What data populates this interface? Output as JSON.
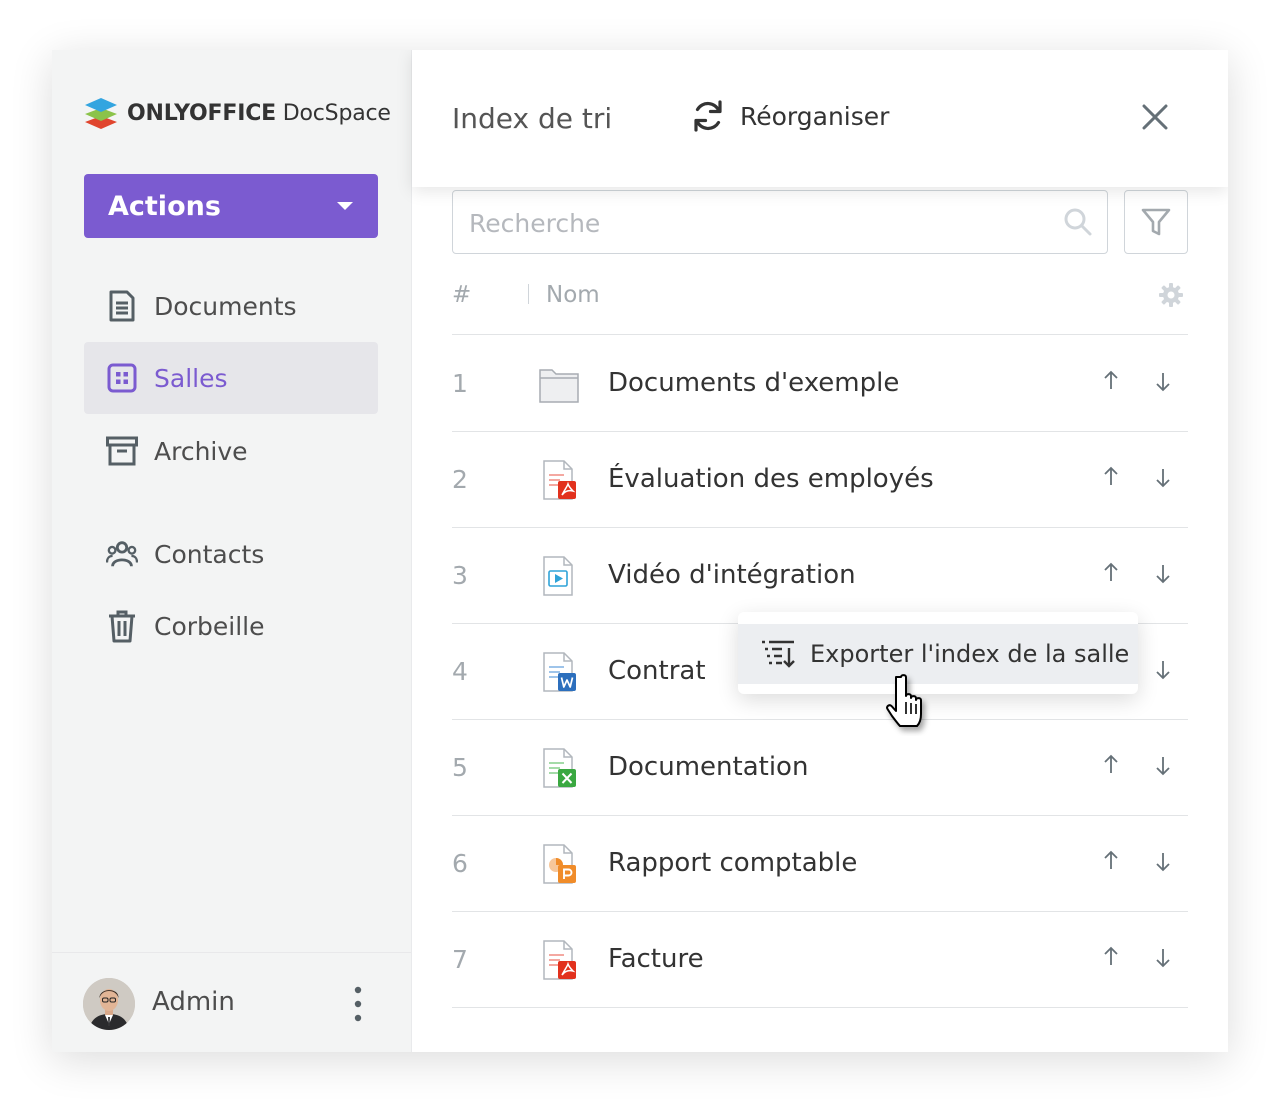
{
  "app": {
    "brand_bold": "ONLYOFFICE",
    "brand_light": " DocSpace"
  },
  "sidebar": {
    "actions_label": "Actions",
    "items": [
      {
        "label": "Documents",
        "icon": "document-icon",
        "active": false
      },
      {
        "label": "Salles",
        "icon": "rooms-icon",
        "active": true
      },
      {
        "label": "Archive",
        "icon": "archive-icon",
        "active": false
      },
      {
        "label": "Contacts",
        "icon": "contacts-icon",
        "active": false
      },
      {
        "label": "Corbeille",
        "icon": "trash-icon",
        "active": false
      }
    ],
    "user": {
      "name": "Admin"
    }
  },
  "panel": {
    "title": "Index de tri",
    "reorganize_label": "Réorganiser",
    "search_placeholder": "Recherche",
    "columns": {
      "number": "#",
      "name": "Nom"
    },
    "rows": [
      {
        "num": "1",
        "name": "Documents d'exemple",
        "type": "folder"
      },
      {
        "num": "2",
        "name": "Évaluation des employés",
        "type": "pdf"
      },
      {
        "num": "3",
        "name": "Vidéo d'intégration",
        "type": "video"
      },
      {
        "num": "4",
        "name": "Contrat",
        "type": "docx"
      },
      {
        "num": "5",
        "name": "Documentation",
        "type": "xlsx"
      },
      {
        "num": "6",
        "name": "Rapport comptable",
        "type": "pptx"
      },
      {
        "num": "7",
        "name": "Facture",
        "type": "pdf"
      }
    ],
    "context_menu": {
      "export_label": "Exporter l'index de la salle"
    }
  },
  "colors": {
    "accent": "#7b5bd0",
    "pdf": "#e2311d",
    "word": "#2c6fbd",
    "excel": "#3aa841",
    "powerpoint": "#f08c2a",
    "video": "#2fa3d8"
  }
}
